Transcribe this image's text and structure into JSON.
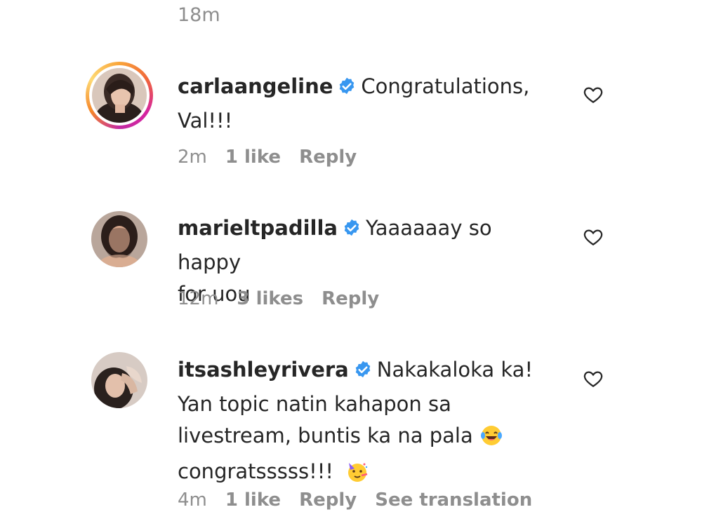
{
  "top_meta": "18m",
  "comments": [
    {
      "username": "carlaangeline",
      "text_line1": "Congratulations,",
      "text_rest": "Val!!!",
      "time": "2m",
      "likes": "1 like",
      "reply": "Reply",
      "verified_icon": "verified-badge-icon",
      "like_icon": "heart-outline-icon"
    },
    {
      "username": "marieltpadilla",
      "text_line1": "Yaaaaaay so happy",
      "text_rest": "for uou",
      "time": "12m",
      "likes": "3 likes",
      "reply": "Reply",
      "verified_icon": "verified-badge-icon",
      "like_icon": "heart-outline-icon"
    },
    {
      "username": "itsashleyrivera",
      "text_line1": "Nakakaloka ka!",
      "text_line2": "Yan topic natin kahapon sa",
      "text_line3": "livestream, buntis ka na pala",
      "text_line4": "congratsssss!!!",
      "time": "4m",
      "likes": "1 like",
      "reply": "Reply",
      "see_translation": "See translation",
      "verified_icon": "verified-badge-icon",
      "like_icon": "heart-outline-icon",
      "emoji_1": "laughing-tears-emoji",
      "emoji_2": "party-face-emoji"
    }
  ],
  "colors": {
    "text": "#262626",
    "secondary": "#8e8e8e",
    "verified": "#3897f0",
    "background": "#ffffff"
  }
}
